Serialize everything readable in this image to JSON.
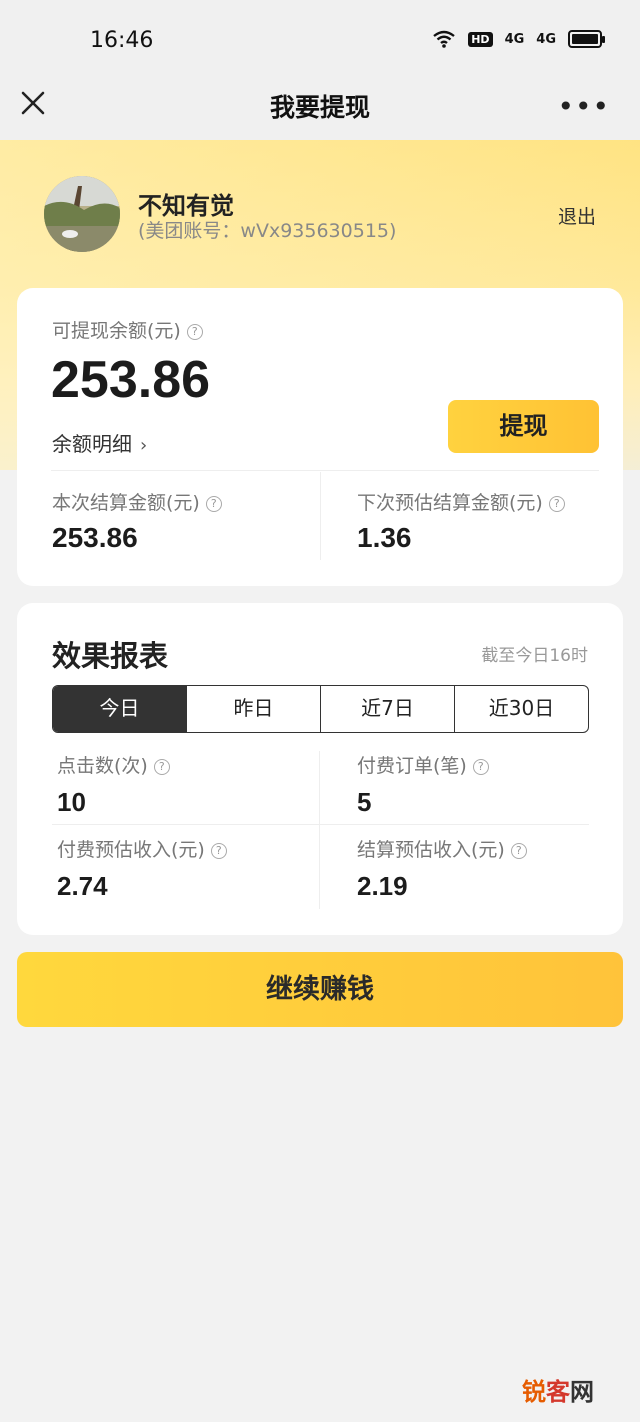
{
  "status_bar": {
    "time": "16:46",
    "hd_label": "HD",
    "net1": "4G",
    "net2": "4G"
  },
  "nav": {
    "title": "我要提现",
    "more": "•••"
  },
  "user": {
    "name": "不知有觉",
    "account": "(美团账号：wVx935630515)",
    "logout": "退出"
  },
  "balance": {
    "label": "可提现余额(元)",
    "value": "253.86",
    "detail_link": "余额明细",
    "withdraw_button": "提现",
    "current_settle_label": "本次结算金额(元)",
    "current_settle_value": "253.86",
    "next_settle_label": "下次预估结算金额(元)",
    "next_settle_value": "1.36"
  },
  "report": {
    "title": "效果报表",
    "note": "截至今日16时",
    "tabs": [
      "今日",
      "昨日",
      "近7日",
      "近30日"
    ],
    "active_tab": 0,
    "stats": {
      "clicks_label": "点击数(次)",
      "clicks_value": "10",
      "paid_orders_label": "付费订单(笔)",
      "paid_orders_value": "5",
      "paid_income_label": "付费预估收入(元)",
      "paid_income_value": "2.74",
      "settle_income_label": "结算预估收入(元)",
      "settle_income_value": "2.19"
    }
  },
  "earn_button": "继续赚钱",
  "watermark": {
    "part1": "锐",
    "part2": "客",
    "part3": "网"
  },
  "colors": {
    "accent": "#ffcc3a",
    "dark_tab": "#333333"
  }
}
